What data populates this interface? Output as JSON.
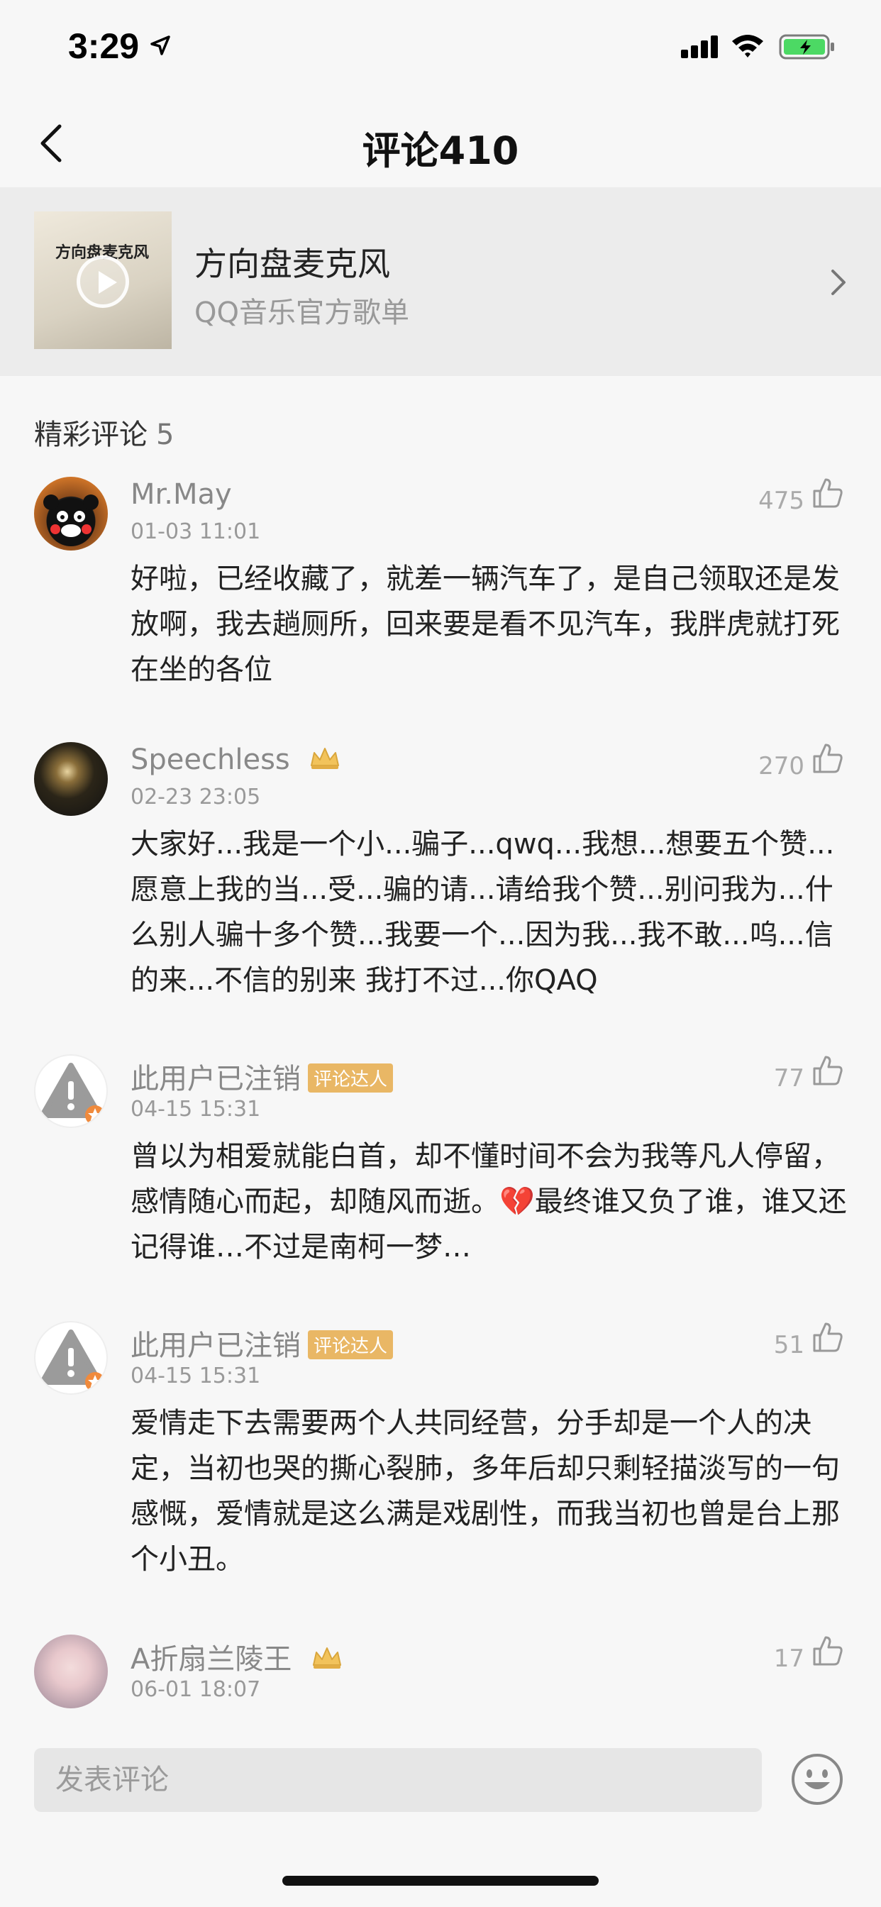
{
  "status_bar": {
    "time": "3:29"
  },
  "header": {
    "title": "评论410"
  },
  "playlist": {
    "name": "方向盘麦克风",
    "subtitle": "QQ音乐官方歌单",
    "cover_title": "方向盘麦克风"
  },
  "section": {
    "title": "精彩评论",
    "count": "5"
  },
  "comments": [
    {
      "user": "Mr.May",
      "time": "01-03 11:01",
      "likes": "475",
      "text": "好啦，已经收藏了，就差一辆汽车了，是自己领取还是发放啊，我去趟厕所，回来要是看不见汽车，我胖虎就打死在坐的各位"
    },
    {
      "user": "Speechless",
      "time": "02-23 23:05",
      "likes": "270",
      "text": "大家好...我是一个小...骗子...qwq...我想...想要五个赞...愿意上我的当...受...骗的请...请给我个赞...别问我为...什么别人骗十多个赞...我要一个...因为我...我不敢...呜...信的来...不信的别来 我打不过...你QAQ"
    },
    {
      "user": "此用户已注销",
      "badge": "评论达人",
      "time": "04-15 15:31",
      "likes": "77",
      "text": "曾以为相爱就能白首，却不懂时间不会为我等凡人停留，感情随心而起，却随风而逝。💔最终谁又负了谁，谁又还记得谁…不过是南柯一梦…"
    },
    {
      "user": "此用户已注销",
      "badge": "评论达人",
      "time": "04-15 15:31",
      "likes": "51",
      "text": "爱情走下去需要两个人共同经营，分手却是一个人的决定，当初也哭的撕心裂肺，多年后却只剩轻描淡写的一句感慨，爱情就是这么满是戏剧性，而我当初也曾是台上那个小丑。"
    },
    {
      "user": "A折扇兰陵王",
      "time": "06-01 18:07",
      "likes": "17",
      "text": ""
    }
  ],
  "input": {
    "placeholder": "发表评论"
  },
  "colors": {
    "badge": "#e9b765",
    "background": "#f7f7f7",
    "card": "#ececec"
  }
}
